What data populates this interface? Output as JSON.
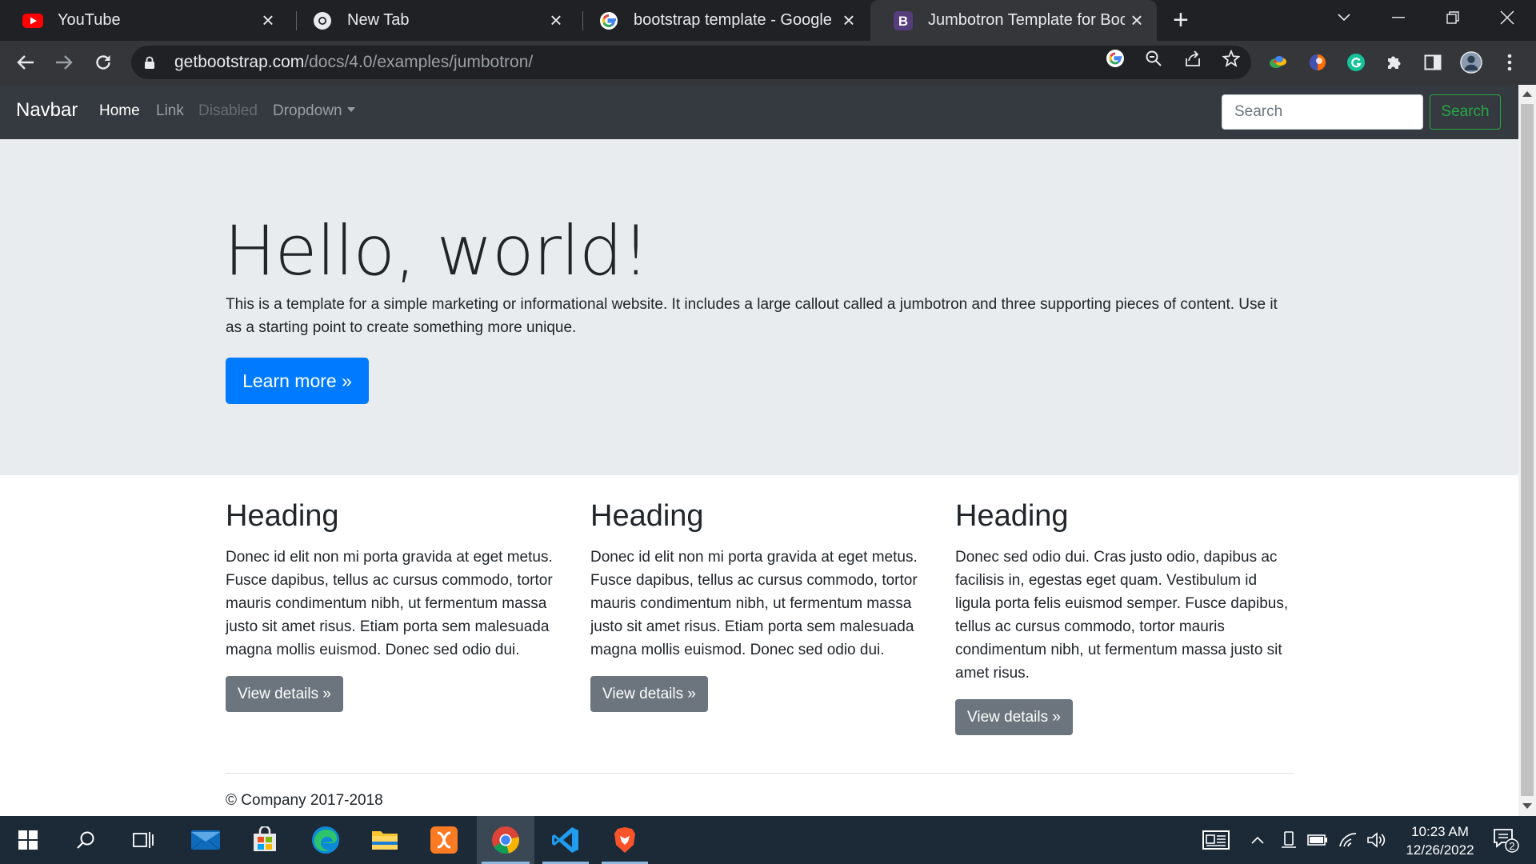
{
  "browser": {
    "tabs": [
      {
        "title": "YouTube",
        "icon": "youtube-icon",
        "active": false
      },
      {
        "title": "New Tab",
        "icon": "chrome-icon",
        "active": false
      },
      {
        "title": "bootstrap template - Google Sea",
        "icon": "google-icon",
        "active": false
      },
      {
        "title": "Jumbotron Template for Bootstra",
        "icon": "bootstrap-icon",
        "active": true
      }
    ],
    "url_domain": "getbootstrap.com",
    "url_path": "/docs/4.0/examples/jumbotron/"
  },
  "navbar": {
    "brand": "Navbar",
    "links": [
      {
        "label": "Home",
        "state": "active"
      },
      {
        "label": "Link",
        "state": "normal"
      },
      {
        "label": "Disabled",
        "state": "disabled"
      },
      {
        "label": "Dropdown",
        "state": "dropdown"
      }
    ],
    "search_placeholder": "Search",
    "search_button": "Search"
  },
  "jumbotron": {
    "heading": "Hello, world!",
    "lead": "This is a template for a simple marketing or informational website. It includes a large callout called a jumbotron and three supporting pieces of content. Use it as a starting point to create something more unique.",
    "button": "Learn more »"
  },
  "columns": [
    {
      "heading": "Heading",
      "text": "Donec id elit non mi porta gravida at eget metus. Fusce dapibus, tellus ac cursus commodo, tortor mauris condimentum nibh, ut fermentum massa justo sit amet risus. Etiam porta sem malesuada magna mollis euismod. Donec sed odio dui.",
      "button": "View details »"
    },
    {
      "heading": "Heading",
      "text": "Donec id elit non mi porta gravida at eget metus. Fusce dapibus, tellus ac cursus commodo, tortor mauris condimentum nibh, ut fermentum massa justo sit amet risus. Etiam porta sem malesuada magna mollis euismod. Donec sed odio dui.",
      "button": "View details »"
    },
    {
      "heading": "Heading",
      "text": "Donec sed odio dui. Cras justo odio, dapibus ac facilisis in, egestas eget quam. Vestibulum id ligula porta felis euismod semper. Fusce dapibus, tellus ac cursus commodo, tortor mauris condimentum nibh, ut fermentum massa justo sit amet risus.",
      "button": "View details »"
    }
  ],
  "footer": {
    "text": "© Company 2017-2018"
  },
  "taskbar": {
    "time": "10:23 AM",
    "date": "12/26/2022",
    "notification_count": "2",
    "apps": [
      "start-icon",
      "search-icon",
      "task-view-icon",
      "mail-icon",
      "microsoft-store-icon",
      "edge-icon",
      "file-explorer-icon",
      "xampp-icon",
      "chrome-icon",
      "vscode-icon",
      "brave-icon"
    ]
  },
  "colors": {
    "navbar_bg": "#343a40",
    "jumbotron_bg": "#e9ecef",
    "primary": "#007bff",
    "secondary": "#6c757d",
    "success": "#28a745"
  }
}
